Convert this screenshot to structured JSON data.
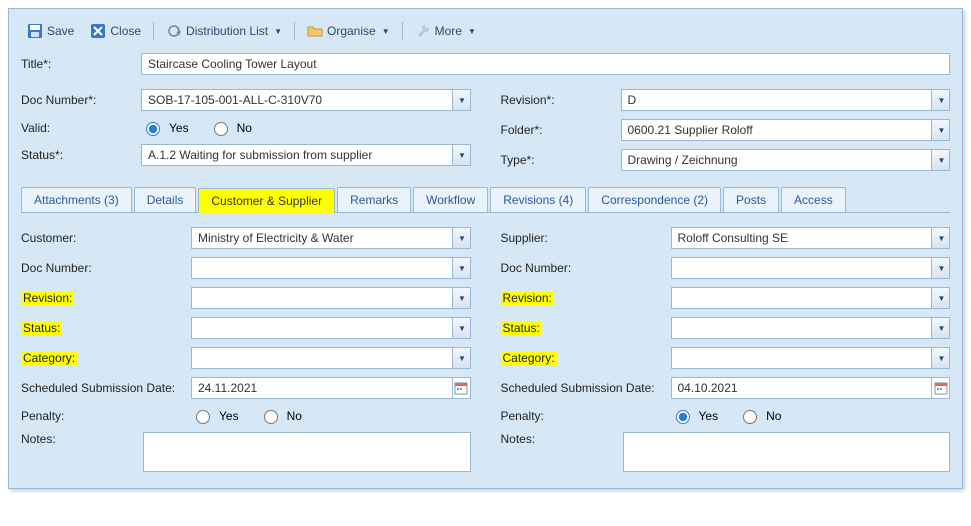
{
  "toolbar": {
    "save": "Save",
    "close": "Close",
    "distribution": "Distribution List",
    "organise": "Organise",
    "more": "More"
  },
  "top": {
    "title_label": "Title*:",
    "title_value": "Staircase Cooling Tower Layout",
    "docnum_label": "Doc Number*:",
    "docnum_value": "SOB-17-105-001-ALL-C-310V70",
    "valid_label": "Valid:",
    "yes": "Yes",
    "no": "No",
    "status_label": "Status*:",
    "status_value": "A.1.2 Waiting for submission from supplier",
    "revision_label": "Revision*:",
    "revision_value": "D",
    "folder_label": "Folder*:",
    "folder_value": "0600.21 Supplier Roloff",
    "type_label": "Type*:",
    "type_value": "Drawing / Zeichnung"
  },
  "tabs": {
    "attachments": "Attachments (3)",
    "details": "Details",
    "custsupp": "Customer & Supplier",
    "remarks": "Remarks",
    "workflow": "Workflow",
    "revisions": "Revisions (4)",
    "correspondence": "Correspondence (2)",
    "posts": "Posts",
    "access": "Access"
  },
  "customer": {
    "section_label": "Customer:",
    "value": "Ministry of Electricity & Water",
    "docnum_label": "Doc Number:",
    "docnum_value": "",
    "revision_label": "Revision:",
    "revision_value": "",
    "status_label": "Status:",
    "status_value": "",
    "category_label": "Category:",
    "category_value": "",
    "sched_label": "Scheduled Submission Date:",
    "sched_value": "24.11.2021",
    "penalty_label": "Penalty:",
    "yes": "Yes",
    "no": "No",
    "notes_label": "Notes:",
    "notes_value": ""
  },
  "supplier": {
    "section_label": "Supplier:",
    "value": "Roloff Consulting SE",
    "docnum_label": "Doc Number:",
    "docnum_value": "",
    "revision_label": "Revision:",
    "revision_value": "",
    "status_label": "Status:",
    "status_value": "",
    "category_label": "Category:",
    "category_value": "",
    "sched_label": "Scheduled Submission Date:",
    "sched_value": "04.10.2021",
    "penalty_label": "Penalty:",
    "yes": "Yes",
    "no": "No",
    "notes_label": "Notes:",
    "notes_value": ""
  }
}
